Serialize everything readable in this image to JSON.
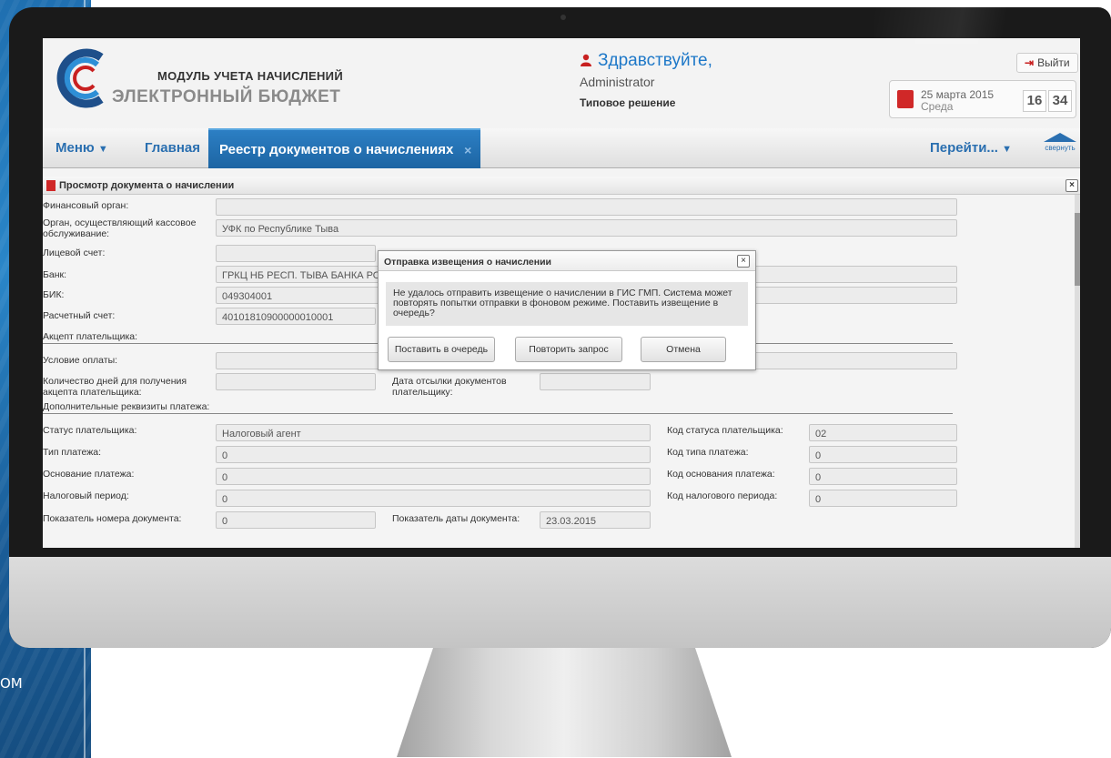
{
  "background": {
    "side_text": "ОМ"
  },
  "header": {
    "logo_line1": "МОДУЛЬ УЧЕТА НАЧИСЛЕНИЙ",
    "logo_line2": "ЭЛЕКТРОННЫЙ БЮДЖЕТ",
    "greeting": "Здравствуйте,",
    "user": "Administrator",
    "solution": "Типовое решение",
    "logout": "Выйти",
    "date": "25 марта 2015",
    "weekday": "Среда",
    "hours": "16",
    "minutes": "34"
  },
  "nav": {
    "menu": "Меню",
    "home": "Главная",
    "active_tab": "Реестр документов о начислениях",
    "tab_close": "×",
    "goto": "Перейти...",
    "collapse": "свернуть"
  },
  "document": {
    "title": "Просмотр документа о начислении",
    "close": "×",
    "fields": {
      "fin_organ": {
        "label": "Финансовый орган:",
        "value": ""
      },
      "cash_organ": {
        "label": "Орган, осуществляющий кассовое обслуживание:",
        "value": "УФК по Республике Тыва"
      },
      "account": {
        "label": "Лицевой счет:",
        "value": ""
      },
      "bank": {
        "label": "Банк:",
        "value": "ГРКЦ НБ РЕСП. ТЫВА БАНКА РОСС"
      },
      "bik": {
        "label": "БИК:",
        "value": "049304001"
      },
      "settlement": {
        "label": "Расчетный счет:",
        "value": "40101810900000010001"
      },
      "acceptance": {
        "label": "Акцепт плательщика:"
      },
      "pay_condition": {
        "label": "Условие оплаты:",
        "value": ""
      },
      "days_accept": {
        "label": "Количество дней для получения акцепта плательщика:",
        "value": ""
      },
      "send_date": {
        "label": "Дата отсылки документов плательщику:",
        "value": ""
      },
      "extra": {
        "label": "Дополнительные реквизиты платежа:"
      },
      "payer_status": {
        "label": "Статус плательщика:",
        "value": "Налоговый агент"
      },
      "payer_status_code": {
        "label": "Код статуса плательщика:",
        "value": "02"
      },
      "pay_type": {
        "label": "Тип платежа:",
        "value": "0"
      },
      "pay_type_code": {
        "label": "Код типа платежа:",
        "value": "0"
      },
      "basis": {
        "label": "Основание платежа:",
        "value": "0"
      },
      "basis_code": {
        "label": "Код основания платежа:",
        "value": "0"
      },
      "tax_period": {
        "label": "Налоговый период:",
        "value": "0"
      },
      "tax_period_code": {
        "label": "Код налогового периода:",
        "value": "0"
      },
      "doc_number": {
        "label": "Показатель номера документа:",
        "value": "0"
      },
      "doc_date": {
        "label": "Показатель даты документа:",
        "value": "23.03.2015"
      }
    }
  },
  "dialog": {
    "title": "Отправка извещения о начислении",
    "close": "×",
    "message": "Не удалось отправить извещение о начислении в ГИС ГМП. Система может повторять попытки отправки в фоновом режиме. Поставить извещение в очередь?",
    "btn_queue": "Поставить в очередь",
    "btn_retry": "Повторить запрос",
    "btn_cancel": "Отмена"
  },
  "colors": {
    "accent": "#1e78c8",
    "active_tab": "#2273b5",
    "alert": "#d02828"
  }
}
